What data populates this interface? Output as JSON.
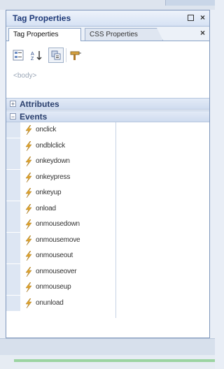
{
  "panel": {
    "title": "Tag Properties",
    "restore_icon": "restore-window-icon",
    "close_icon": "close-icon"
  },
  "tabs": [
    {
      "label": "Tag Properties",
      "active": true
    },
    {
      "label": "CSS Properties",
      "active": false
    }
  ],
  "toolbar": {
    "buttons": [
      {
        "icon": "categorized-view-icon",
        "pressed": false
      },
      {
        "icon": "sort-alphabetical-icon",
        "pressed": false
      },
      {
        "icon": "show-set-properties-icon",
        "pressed": true
      },
      {
        "icon": "properties-brush-icon",
        "pressed": false
      }
    ]
  },
  "tag_path": "<body>",
  "sections": {
    "attributes": {
      "toggle": "+",
      "label": "Attributes"
    },
    "events": {
      "toggle": "−",
      "label": "Events"
    }
  },
  "events": [
    "onclick",
    "ondblclick",
    "onkeydown",
    "onkeypress",
    "onkeyup",
    "onload",
    "onmousedown",
    "onmousemove",
    "onmouseout",
    "onmouseover",
    "onmouseup",
    "onunload"
  ],
  "colors": {
    "title_text": "#1f3a78",
    "header_band": "#cfdcef",
    "event_icon": "#e2a52c"
  }
}
